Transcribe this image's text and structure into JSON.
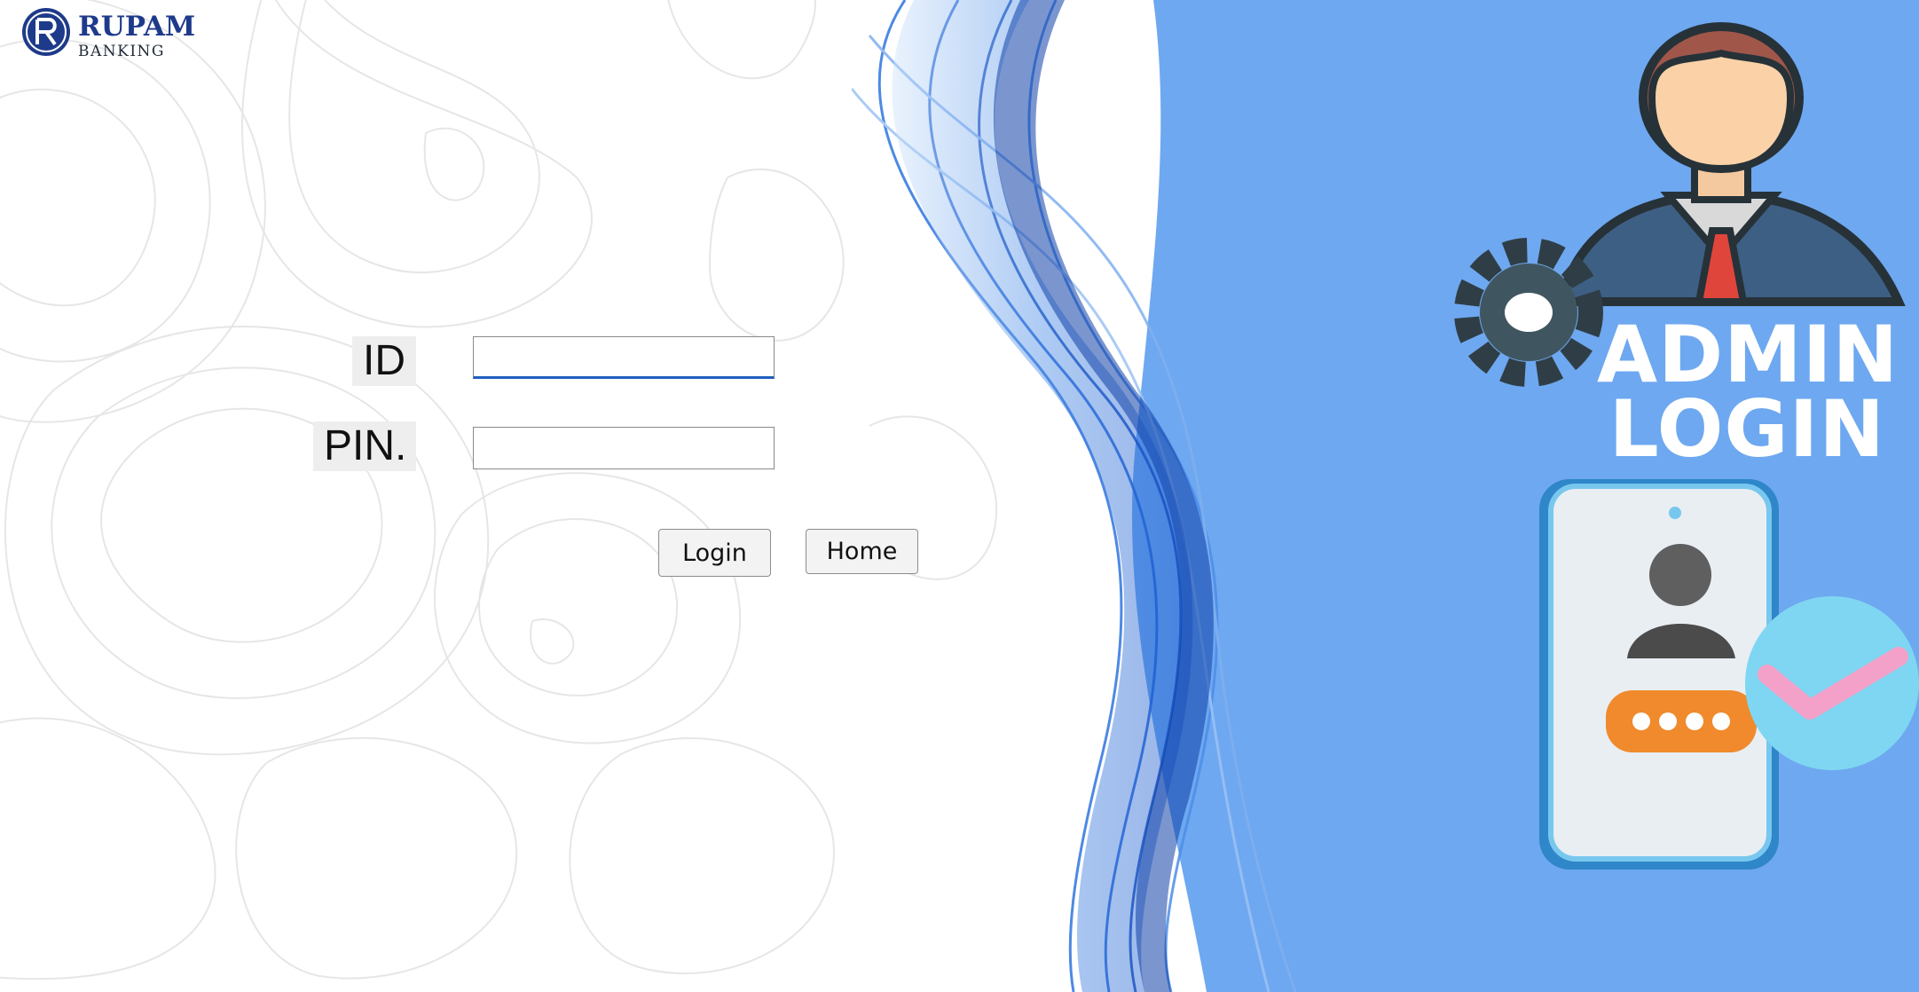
{
  "brand": {
    "name": "RUPAM",
    "subtitle": "BANKING",
    "primary_color": "#1e3a8a"
  },
  "form": {
    "id_label": "ID",
    "id_value": "",
    "pin_label": "PIN.",
    "pin_value": "",
    "login_button": "Login",
    "home_button": "Home"
  },
  "hero": {
    "title_line1": "ADMIN",
    "title_line2": "LOGIN",
    "background_color": "#6ea8f0",
    "accent_color": "#1559d6"
  }
}
